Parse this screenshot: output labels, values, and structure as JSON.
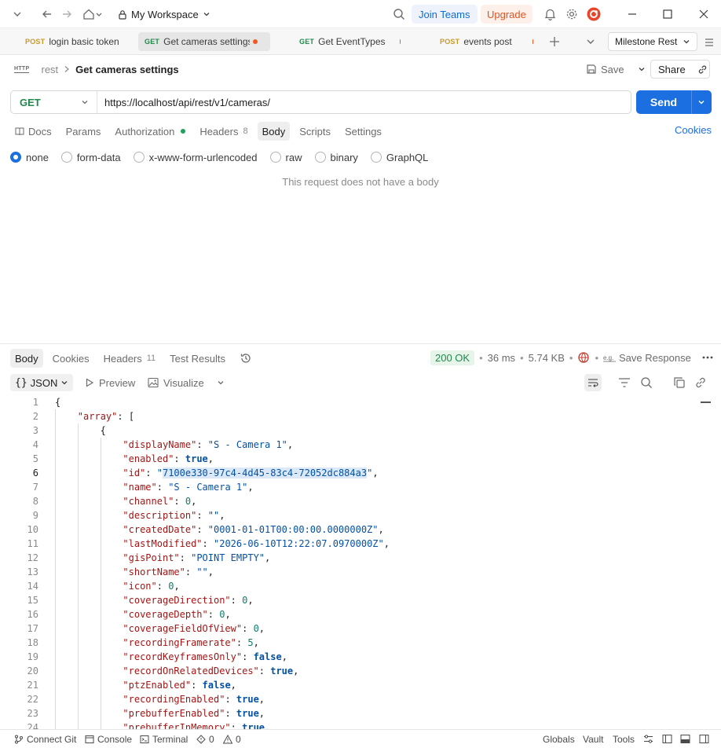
{
  "titlebar": {
    "workspace_name": "My Workspace",
    "join_teams": "Join Teams",
    "upgrade": "Upgrade"
  },
  "tabs": [
    {
      "method": "POST",
      "label": "login basic token",
      "unsaved": false
    },
    {
      "method": "GET",
      "label": "Get cameras settings",
      "unsaved": true
    },
    {
      "method": "GET",
      "label": "Get EventTypes",
      "unsaved": true
    },
    {
      "method": "POST",
      "label": "events post",
      "unsaved": true
    }
  ],
  "environment": "Milestone Rest",
  "request": {
    "badge": "HTTP",
    "collection": "rest",
    "name": "Get cameras settings",
    "save_label": "Save",
    "share_label": "Share",
    "method": "GET",
    "url": "https://localhost/api/rest/v1/cameras/",
    "send_label": "Send"
  },
  "request_tabs": [
    {
      "label": "Docs"
    },
    {
      "label": "Params"
    },
    {
      "label": "Authorization"
    },
    {
      "label": "Headers",
      "count": "8"
    },
    {
      "label": "Body"
    },
    {
      "label": "Scripts"
    },
    {
      "label": "Settings"
    }
  ],
  "cookies_label": "Cookies",
  "body_types": [
    "none",
    "form-data",
    "x-www-form-urlencoded",
    "raw",
    "binary",
    "GraphQL"
  ],
  "selected_body_type": "none",
  "no_body_text": "This request does not have a body",
  "response": {
    "tabs": [
      {
        "label": "Body"
      },
      {
        "label": "Cookies"
      },
      {
        "label": "Headers",
        "count": "11"
      },
      {
        "label": "Test Results"
      }
    ],
    "status": "200 OK",
    "time": "36 ms",
    "size": "5.74 KB",
    "save_response": "Save Response",
    "format": "JSON",
    "preview": "Preview",
    "visualize": "Visualize"
  },
  "code_lines": [
    {
      "n": "1",
      "indent": 0,
      "parts": [
        [
          "p",
          "{"
        ]
      ]
    },
    {
      "n": "2",
      "indent": 1,
      "parts": [
        [
          "k",
          "\"array\""
        ],
        [
          "p",
          ": ["
        ]
      ]
    },
    {
      "n": "3",
      "indent": 2,
      "parts": [
        [
          "p",
          "{"
        ]
      ]
    },
    {
      "n": "4",
      "indent": 3,
      "parts": [
        [
          "k",
          "\"displayName\""
        ],
        [
          "p",
          ": "
        ],
        [
          "s",
          "\"S - Camera 1\""
        ],
        [
          "p",
          ","
        ]
      ]
    },
    {
      "n": "5",
      "indent": 3,
      "parts": [
        [
          "k",
          "\"enabled\""
        ],
        [
          "p",
          ": "
        ],
        [
          "b",
          "true"
        ],
        [
          "p",
          ","
        ]
      ]
    },
    {
      "n": "6",
      "indent": 3,
      "parts": [
        [
          "k",
          "\"id\""
        ],
        [
          "p",
          ": "
        ],
        [
          "s",
          "\""
        ],
        [
          "hl",
          "7100e330-97c4-4d45-83c4-72052dc884a3"
        ],
        [
          "s",
          "\""
        ],
        [
          "p",
          ","
        ]
      ]
    },
    {
      "n": "7",
      "indent": 3,
      "parts": [
        [
          "k",
          "\"name\""
        ],
        [
          "p",
          ": "
        ],
        [
          "s",
          "\"S - Camera 1\""
        ],
        [
          "p",
          ","
        ]
      ]
    },
    {
      "n": "8",
      "indent": 3,
      "parts": [
        [
          "k",
          "\"channel\""
        ],
        [
          "p",
          ": "
        ],
        [
          "n",
          "0"
        ],
        [
          "p",
          ","
        ]
      ]
    },
    {
      "n": "9",
      "indent": 3,
      "parts": [
        [
          "k",
          "\"description\""
        ],
        [
          "p",
          ": "
        ],
        [
          "s",
          "\"\""
        ],
        [
          "p",
          ","
        ]
      ]
    },
    {
      "n": "10",
      "indent": 3,
      "parts": [
        [
          "k",
          "\"createdDate\""
        ],
        [
          "p",
          ": "
        ],
        [
          "s",
          "\"0001-01-01T00:00:00.0000000Z\""
        ],
        [
          "p",
          ","
        ]
      ]
    },
    {
      "n": "11",
      "indent": 3,
      "parts": [
        [
          "k",
          "\"lastModified\""
        ],
        [
          "p",
          ": "
        ],
        [
          "s",
          "\"2026-06-10T12:22:07.0970000Z\""
        ],
        [
          "p",
          ","
        ]
      ]
    },
    {
      "n": "12",
      "indent": 3,
      "parts": [
        [
          "k",
          "\"gisPoint\""
        ],
        [
          "p",
          ": "
        ],
        [
          "s",
          "\"POINT EMPTY\""
        ],
        [
          "p",
          ","
        ]
      ]
    },
    {
      "n": "13",
      "indent": 3,
      "parts": [
        [
          "k",
          "\"shortName\""
        ],
        [
          "p",
          ": "
        ],
        [
          "s",
          "\"\""
        ],
        [
          "p",
          ","
        ]
      ]
    },
    {
      "n": "14",
      "indent": 3,
      "parts": [
        [
          "k",
          "\"icon\""
        ],
        [
          "p",
          ": "
        ],
        [
          "n",
          "0"
        ],
        [
          "p",
          ","
        ]
      ]
    },
    {
      "n": "15",
      "indent": 3,
      "parts": [
        [
          "k",
          "\"coverageDirection\""
        ],
        [
          "p",
          ": "
        ],
        [
          "n",
          "0"
        ],
        [
          "p",
          ","
        ]
      ]
    },
    {
      "n": "16",
      "indent": 3,
      "parts": [
        [
          "k",
          "\"coverageDepth\""
        ],
        [
          "p",
          ": "
        ],
        [
          "n",
          "0"
        ],
        [
          "p",
          ","
        ]
      ]
    },
    {
      "n": "17",
      "indent": 3,
      "parts": [
        [
          "k",
          "\"coverageFieldOfView\""
        ],
        [
          "p",
          ": "
        ],
        [
          "n",
          "0"
        ],
        [
          "p",
          ","
        ]
      ]
    },
    {
      "n": "18",
      "indent": 3,
      "parts": [
        [
          "k",
          "\"recordingFramerate\""
        ],
        [
          "p",
          ": "
        ],
        [
          "n",
          "5"
        ],
        [
          "p",
          ","
        ]
      ]
    },
    {
      "n": "19",
      "indent": 3,
      "parts": [
        [
          "k",
          "\"recordKeyframesOnly\""
        ],
        [
          "p",
          ": "
        ],
        [
          "b",
          "false"
        ],
        [
          "p",
          ","
        ]
      ]
    },
    {
      "n": "20",
      "indent": 3,
      "parts": [
        [
          "k",
          "\"recordOnRelatedDevices\""
        ],
        [
          "p",
          ": "
        ],
        [
          "b",
          "true"
        ],
        [
          "p",
          ","
        ]
      ]
    },
    {
      "n": "21",
      "indent": 3,
      "parts": [
        [
          "k",
          "\"ptzEnabled\""
        ],
        [
          "p",
          ": "
        ],
        [
          "b",
          "false"
        ],
        [
          "p",
          ","
        ]
      ]
    },
    {
      "n": "22",
      "indent": 3,
      "parts": [
        [
          "k",
          "\"recordingEnabled\""
        ],
        [
          "p",
          ": "
        ],
        [
          "b",
          "true"
        ],
        [
          "p",
          ","
        ]
      ]
    },
    {
      "n": "23",
      "indent": 3,
      "parts": [
        [
          "k",
          "\"prebufferEnabled\""
        ],
        [
          "p",
          ": "
        ],
        [
          "b",
          "true"
        ],
        [
          "p",
          ","
        ]
      ]
    },
    {
      "n": "24",
      "indent": 3,
      "parts": [
        [
          "k",
          "\"prebufferInMemory\""
        ],
        [
          "p",
          ": "
        ],
        [
          "b",
          "true"
        ],
        [
          "p",
          ","
        ]
      ]
    }
  ],
  "current_line": "6",
  "statusbar": {
    "connect_git": "Connect Git",
    "console": "Console",
    "terminal": "Terminal",
    "errors": "0",
    "warnings": "0",
    "globals": "Globals",
    "vault": "Vault",
    "tools": "Tools"
  },
  "colors": {
    "accent": "#1c6fe0",
    "get_method": "#1f8a4c",
    "post_method": "#c79a2c",
    "unsaved_dot": "#ef5b25",
    "upgrade": "#e0541f"
  }
}
